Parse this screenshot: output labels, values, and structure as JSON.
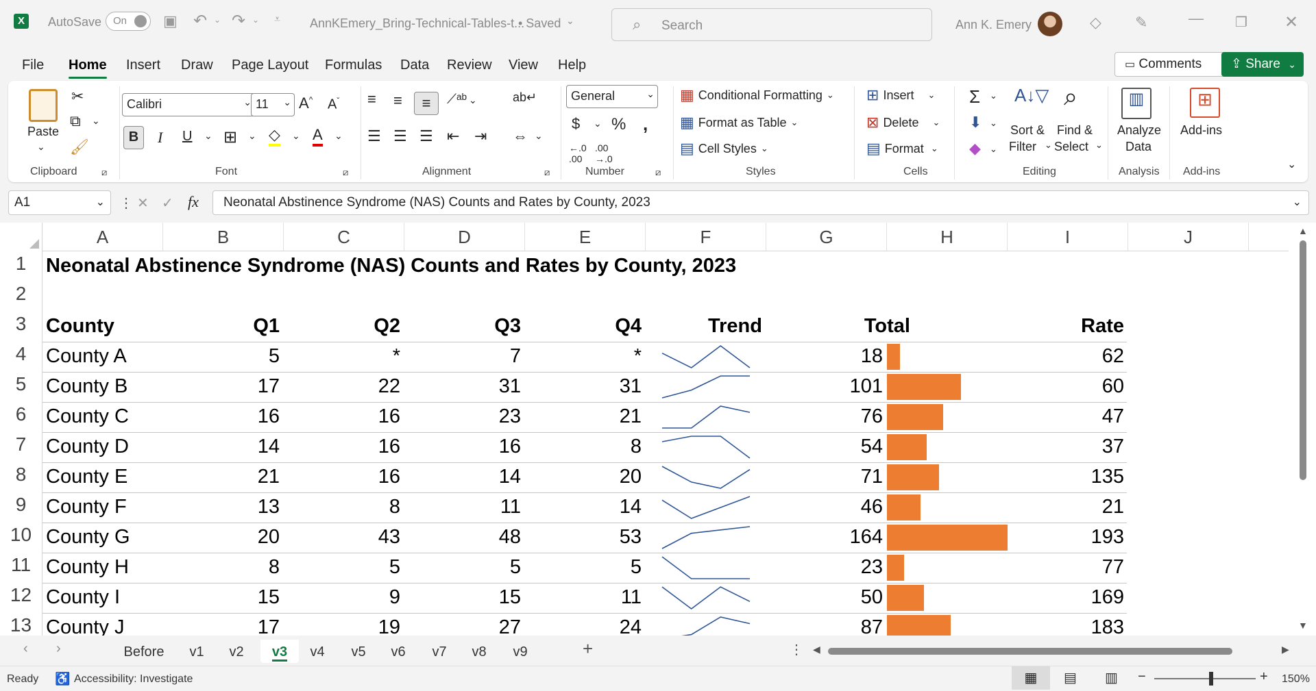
{
  "titlebar": {
    "autosave_label": "AutoSave",
    "autosave_state": "On",
    "file_name": "AnnKEmery_Bring-Technical-Tables-t...",
    "saved_status": "• Saved",
    "search_placeholder": "Search",
    "user_name": "Ann K. Emery"
  },
  "menu_tabs": [
    "File",
    "Home",
    "Insert",
    "Draw",
    "Page Layout",
    "Formulas",
    "Data",
    "Review",
    "View",
    "Help"
  ],
  "comments_label": "Comments",
  "share_label": "Share",
  "ribbon": {
    "clipboard": {
      "paste": "Paste",
      "group": "Clipboard"
    },
    "font": {
      "name": "Calibri",
      "size": "11",
      "bold": "B",
      "italic": "I",
      "underline": "U",
      "group": "Font"
    },
    "alignment": {
      "group": "Alignment"
    },
    "number": {
      "format": "General",
      "group": "Number"
    },
    "styles": {
      "conditional": "Conditional Formatting",
      "table": "Format as Table",
      "cell": "Cell Styles",
      "group": "Styles"
    },
    "cells": {
      "insert": "Insert",
      "delete": "Delete",
      "format": "Format",
      "group": "Cells"
    },
    "editing": {
      "sort1": "Sort &",
      "sort2": "Filter",
      "find1": "Find &",
      "find2": "Select",
      "group": "Editing"
    },
    "analysis": {
      "l1": "Analyze",
      "l2": "Data",
      "group": "Analysis"
    },
    "addins": {
      "label": "Add-ins",
      "group": "Add-ins"
    }
  },
  "formula": {
    "namebox": "A1",
    "content": "Neonatal Abstinence Syndrome (NAS) Counts and Rates by County, 2023"
  },
  "columns": [
    "A",
    "B",
    "C",
    "D",
    "E",
    "F",
    "G",
    "H",
    "I",
    "J"
  ],
  "sheet": {
    "title": "Neonatal Abstinence Syndrome (NAS) Counts and Rates by County, 2023",
    "headers": {
      "county": "County",
      "q1": "Q1",
      "q2": "Q2",
      "q3": "Q3",
      "q4": "Q4",
      "trend": "Trend",
      "total": "Total",
      "rate": "Rate"
    },
    "rows": [
      {
        "county": "County A",
        "q1": "5",
        "q2": "*",
        "q3": "7",
        "q4": "*",
        "total": "18",
        "rate": "62",
        "trend": [
          2,
          0,
          3,
          0
        ]
      },
      {
        "county": "County B",
        "q1": "17",
        "q2": "22",
        "q3": "31",
        "q4": "31",
        "total": "101",
        "rate": "60",
        "trend": [
          17,
          22,
          31,
          31
        ]
      },
      {
        "county": "County C",
        "q1": "16",
        "q2": "16",
        "q3": "23",
        "q4": "21",
        "total": "76",
        "rate": "47",
        "trend": [
          16,
          16,
          23,
          21
        ]
      },
      {
        "county": "County D",
        "q1": "14",
        "q2": "16",
        "q3": "16",
        "q4": "8",
        "total": "54",
        "rate": "37",
        "trend": [
          14,
          16,
          16,
          8
        ]
      },
      {
        "county": "County E",
        "q1": "21",
        "q2": "16",
        "q3": "14",
        "q4": "20",
        "total": "71",
        "rate": "135",
        "trend": [
          21,
          16,
          14,
          20
        ]
      },
      {
        "county": "County F",
        "q1": "13",
        "q2": "8",
        "q3": "11",
        "q4": "14",
        "total": "46",
        "rate": "21",
        "trend": [
          13,
          8,
          11,
          14
        ]
      },
      {
        "county": "County G",
        "q1": "20",
        "q2": "43",
        "q3": "48",
        "q4": "53",
        "total": "164",
        "rate": "193",
        "trend": [
          20,
          43,
          48,
          53
        ]
      },
      {
        "county": "County H",
        "q1": "8",
        "q2": "5",
        "q3": "5",
        "q4": "5",
        "total": "23",
        "rate": "77",
        "trend": [
          8,
          5,
          5,
          5
        ]
      },
      {
        "county": "County I",
        "q1": "15",
        "q2": "9",
        "q3": "15",
        "q4": "11",
        "total": "50",
        "rate": "169",
        "trend": [
          15,
          9,
          15,
          11
        ]
      },
      {
        "county": "County J",
        "q1": "17",
        "q2": "19",
        "q3": "27",
        "q4": "24",
        "total": "87",
        "rate": "183",
        "trend": [
          17,
          19,
          27,
          24
        ]
      }
    ],
    "row_numbers": [
      "1",
      "2",
      "3",
      "4",
      "5",
      "6",
      "7",
      "8",
      "9",
      "10",
      "11",
      "12",
      "13"
    ],
    "bar_max_total": 164
  },
  "sheet_tabs": [
    "Before",
    "v1",
    "v2",
    "v3",
    "v4",
    "v5",
    "v6",
    "v7",
    "v8",
    "v9"
  ],
  "active_sheet": "v3",
  "status": {
    "ready": "Ready",
    "accessibility": "Accessibility: Investigate",
    "zoom": "150%"
  },
  "colors": {
    "excel_green": "#107c41",
    "bar": "#ed7d31",
    "sparkline": "#2f5597"
  }
}
